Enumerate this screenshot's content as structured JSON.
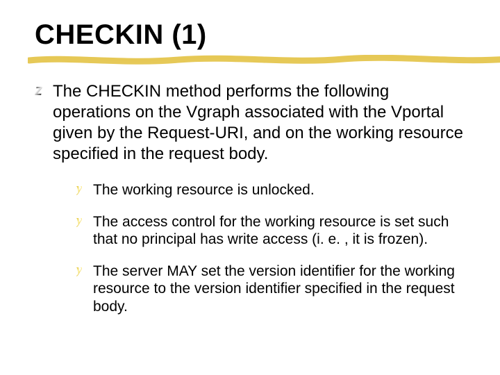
{
  "title": "CHECKIN (1)",
  "bullets": [
    {
      "marker": "z",
      "text": "The CHECKIN method performs the following operations on the Vgraph associated with the Vportal given by the Request-URI, and on the working resource specified in the request body.",
      "sub": [
        {
          "marker": "y",
          "text": "The working resource is unlocked."
        },
        {
          "marker": "y",
          "text": "The access control for the working resource is set such that no principal has write access (i. e. , it is frozen)."
        },
        {
          "marker": "y",
          "text": "The server MAY set the version identifier for the working resource to the version identifier specified in the request body."
        }
      ]
    }
  ],
  "colors": {
    "underline_stroke": "#e3c242"
  }
}
